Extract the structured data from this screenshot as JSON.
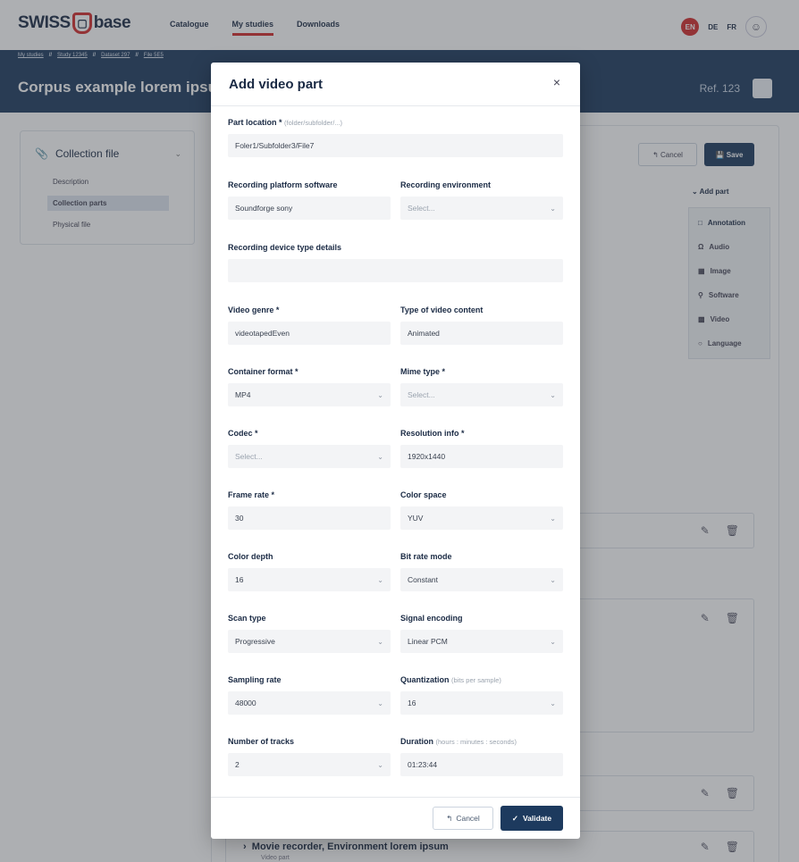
{
  "header": {
    "logo_left": "SWISS",
    "logo_right": "base",
    "nav": [
      "Catalogue",
      "My studies",
      "Downloads"
    ],
    "langs": [
      "EN",
      "DE",
      "FR"
    ]
  },
  "breadcrumb": [
    "My studies",
    "Study 12345",
    "Dataset 297",
    "File 5E5"
  ],
  "study": {
    "title": "Corpus example lorem ipsum",
    "ref": "Ref. 123"
  },
  "sidebar": {
    "title": "Collection file",
    "items": [
      "Description",
      "Collection parts",
      "Physical file"
    ]
  },
  "toolbar": {
    "cancel": "Cancel",
    "save": "Save",
    "add_part": "Add part"
  },
  "add_menu": [
    "Annotation",
    "Audio",
    "Image",
    "Software",
    "Video",
    "Language"
  ],
  "movie_row": {
    "title": "Movie recorder, Environment lorem ipsum",
    "sub": "Video part"
  },
  "modal": {
    "title": "Add video part",
    "close": "×",
    "part_location": {
      "label": "Part location *",
      "hint": "(folder/subfolder/...)",
      "value": "Foler1/Subfolder3/File7"
    },
    "fields": [
      {
        "label": "Recording platform software",
        "value": "Soundforge sony",
        "select": false,
        "placeholder": false
      },
      {
        "label": "Recording environment",
        "value": "Select...",
        "select": true,
        "placeholder": true
      },
      {
        "label": "Video genre *",
        "value": "videotapedEven",
        "select": false,
        "placeholder": false
      },
      {
        "label": "Type of video content",
        "value": "Animated",
        "select": false,
        "placeholder": false
      },
      {
        "label": "Container format *",
        "value": "MP4",
        "select": true,
        "placeholder": false
      },
      {
        "label": "Mime type *",
        "value": "Select...",
        "select": true,
        "placeholder": true
      },
      {
        "label": "Codec *",
        "value": "Select...",
        "select": true,
        "placeholder": true
      },
      {
        "label": "Resolution info *",
        "value": "1920x1440",
        "select": false,
        "placeholder": false
      },
      {
        "label": "Frame rate *",
        "value": "30",
        "select": false,
        "placeholder": false
      },
      {
        "label": "Color space",
        "value": "YUV",
        "select": true,
        "placeholder": false
      },
      {
        "label": "Color depth",
        "value": "16",
        "select": true,
        "placeholder": false
      },
      {
        "label": "Bit rate mode",
        "value": "Constant",
        "select": true,
        "placeholder": false
      },
      {
        "label": "Scan type",
        "value": "Progressive",
        "select": true,
        "placeholder": false
      },
      {
        "label": "Signal encoding",
        "value": "Linear PCM",
        "select": true,
        "placeholder": false
      },
      {
        "label": "Sampling rate",
        "value": "48000",
        "select": true,
        "placeholder": false
      },
      {
        "label": "Quantization",
        "hint": "(bits per sample)",
        "value": "16",
        "select": true,
        "placeholder": false
      },
      {
        "label": "Number of tracks",
        "value": "2",
        "select": true,
        "placeholder": false
      },
      {
        "label": "Duration",
        "hint": "(hours : minutes : seconds)",
        "value": "01:23:44",
        "select": false,
        "placeholder": false
      }
    ],
    "device_details": {
      "label": "Recording device type details",
      "value": ""
    },
    "cancel": "Cancel",
    "validate": "Validate"
  }
}
